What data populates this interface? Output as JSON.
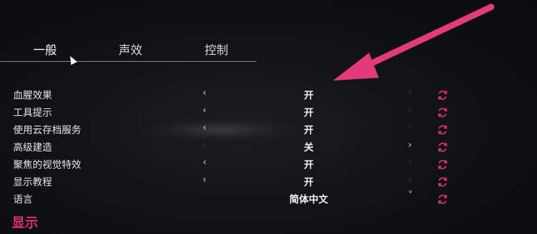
{
  "tabs": [
    {
      "label": "一般",
      "active": true
    },
    {
      "label": "声效",
      "active": false
    },
    {
      "label": "控制",
      "active": false
    }
  ],
  "settings": [
    {
      "label": "血腥效果",
      "value": "开",
      "left_enabled": true,
      "right_enabled": false
    },
    {
      "label": "工具提示",
      "value": "开",
      "left_enabled": true,
      "right_enabled": false
    },
    {
      "label": "使用云存档服务",
      "value": "开",
      "left_enabled": true,
      "right_enabled": false
    },
    {
      "label": "高级建造",
      "value": "关",
      "left_enabled": false,
      "right_enabled": true
    },
    {
      "label": "聚焦的视觉特效",
      "value": "开",
      "left_enabled": true,
      "right_enabled": false
    },
    {
      "label": "显示教程",
      "value": "开",
      "left_enabled": true,
      "right_enabled": false
    },
    {
      "label": "语言",
      "value": "简体中文",
      "dropdown": true
    }
  ],
  "glyphs": {
    "left_arrow": "‹",
    "right_arrow": "›",
    "dropdown": "˅"
  },
  "section": {
    "title": "显示"
  },
  "colors": {
    "accent": "#e0306e",
    "annotation_arrow": "#e23a7a"
  }
}
